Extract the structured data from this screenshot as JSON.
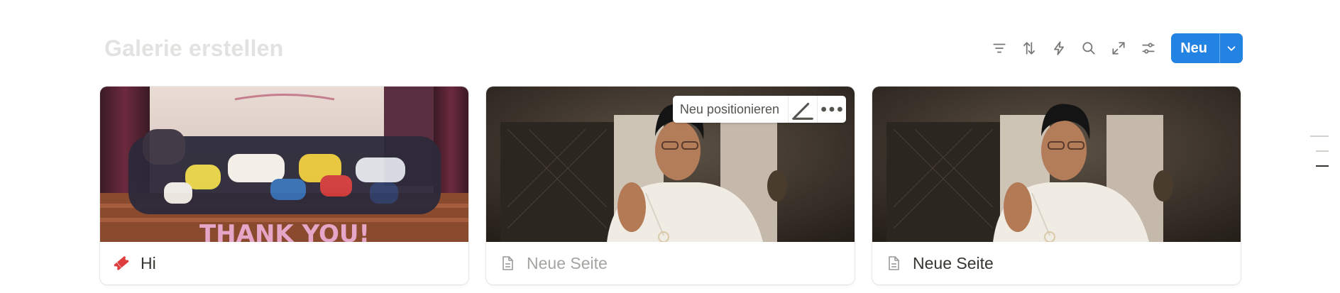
{
  "page": {
    "title": "Galerie erstellen"
  },
  "toolbar": {
    "icons": [
      "filter-icon",
      "sort-icon",
      "automation-icon",
      "search-icon",
      "expand-icon",
      "settings-icon"
    ],
    "new_label": "Neu"
  },
  "cards": [
    {
      "title": "Hi",
      "icon": "ticket-icon",
      "icon_color": "#e03e3e",
      "title_muted": false
    },
    {
      "title": "Neue Seite",
      "icon": "page-icon",
      "title_muted": true,
      "cover_tools": {
        "reposition_label": "Neu positionieren"
      }
    },
    {
      "title": "Neue Seite",
      "icon": "page-icon",
      "title_muted": false
    }
  ],
  "colors": {
    "accent": "#2383e2",
    "title_placeholder": "#e3e2e0"
  }
}
